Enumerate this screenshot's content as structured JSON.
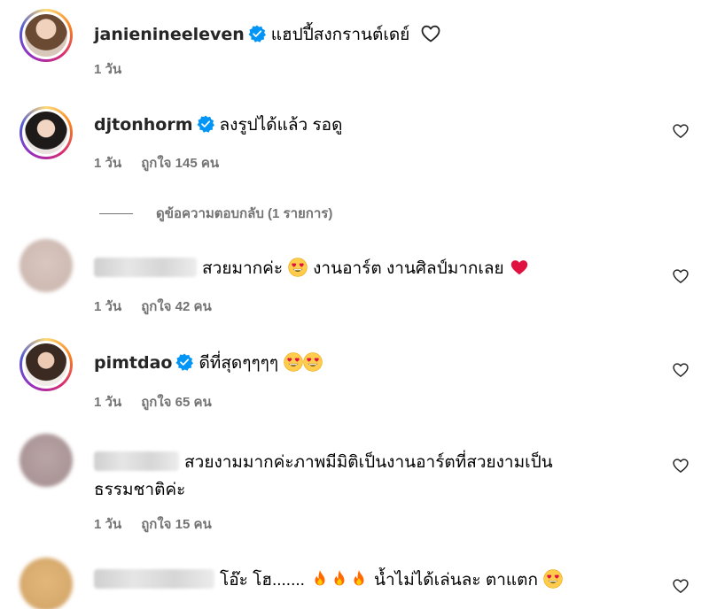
{
  "comments": [
    {
      "username": "janienineeleven",
      "verified": true,
      "text": "แฮปปี้สงกรานต์เดย์",
      "time": "1 วัน",
      "likes": ""
    },
    {
      "username": "djtonhorm",
      "verified": true,
      "text": "ลงรูปได้แล้ว รอดู",
      "time": "1 วัน",
      "likes": "ถูกใจ 145 คน"
    },
    {
      "username": "",
      "verified": false,
      "text_a": "สวยมากค่ะ",
      "text_b": "งานอาร์ต งานศิลป์มากเลย",
      "time": "1 วัน",
      "likes": "ถูกใจ 42 คน"
    },
    {
      "username": "pimtdao",
      "verified": true,
      "text": "ดีที่สุดๆๆๆๆ",
      "time": "1 วัน",
      "likes": "ถูกใจ 65 คน"
    },
    {
      "username": "",
      "verified": false,
      "text_line1": "สวยงามมากค่ะภาพมีมิติเป็นงานอาร์ตที่สวยงามเป็น",
      "text_line2": "ธรรมชาติค่ะ",
      "time": "1 วัน",
      "likes": "ถูกใจ 15 คน"
    },
    {
      "username": "",
      "verified": false,
      "text_a": "โอ๊ะ โฮ.......",
      "text_b": "น้ำไม่ได้เล่นละ ตาแตก",
      "time": "",
      "likes": ""
    }
  ],
  "replies": {
    "label": "ดูข้อความตอบกลับ (1 รายการ)"
  },
  "colors": {
    "verified": "#0095f6",
    "meta": "#737373",
    "heart_red": "#e0113f",
    "fire": "#ff6a00"
  },
  "icons": [
    "verified-badge-icon",
    "heart-outline-icon",
    "heart-eyes-emoji",
    "red-heart-emoji",
    "fire-emoji"
  ]
}
